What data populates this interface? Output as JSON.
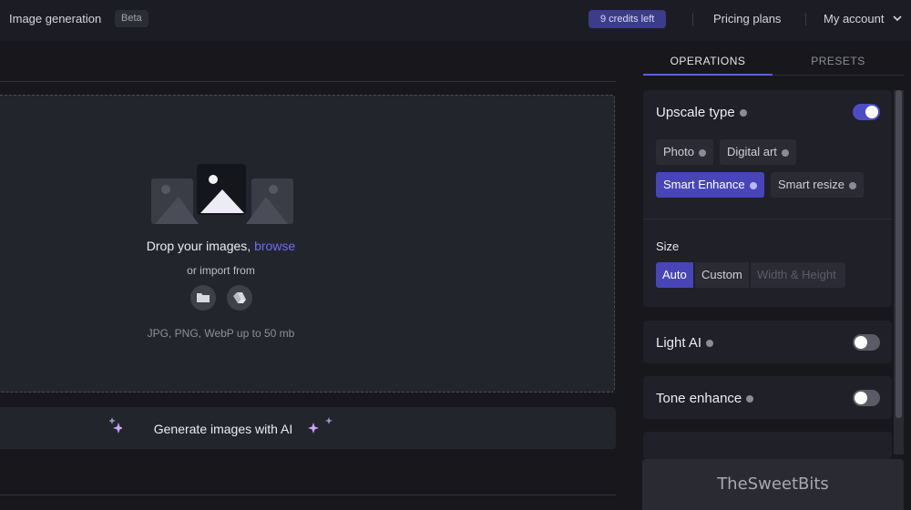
{
  "header": {
    "title": "Image generation",
    "badge": "Beta",
    "credits": "9 credits left",
    "pricing": "Pricing plans",
    "account": "My account"
  },
  "upload": {
    "drop_text": "Drop your images,",
    "browse": "browse",
    "import_text": "or import from",
    "formats": "JPG, PNG, WebP up to 50 mb",
    "import_icons": [
      "folder-icon",
      "google-drive-icon"
    ]
  },
  "generate": {
    "label": "Generate images with AI"
  },
  "panel": {
    "tabs": [
      "OPERATIONS",
      "PRESETS"
    ],
    "active_tab": "OPERATIONS",
    "upscale": {
      "title": "Upscale type",
      "enabled": true,
      "options": [
        "Photo",
        "Digital art",
        "Smart Enhance",
        "Smart resize"
      ],
      "selected": "Smart Enhance"
    },
    "size": {
      "label": "Size",
      "options": [
        "Auto",
        "Custom",
        "Width & Height"
      ],
      "selected": "Auto"
    },
    "light_ai": {
      "title": "Light AI",
      "enabled": false
    },
    "tone_enhance": {
      "title": "Tone enhance",
      "enabled": false
    }
  },
  "watermark": "TheSweetBits",
  "colors": {
    "accent": "#4745b8",
    "link": "#6f6cf0",
    "background": "#17171c",
    "card": "#1f2028"
  }
}
